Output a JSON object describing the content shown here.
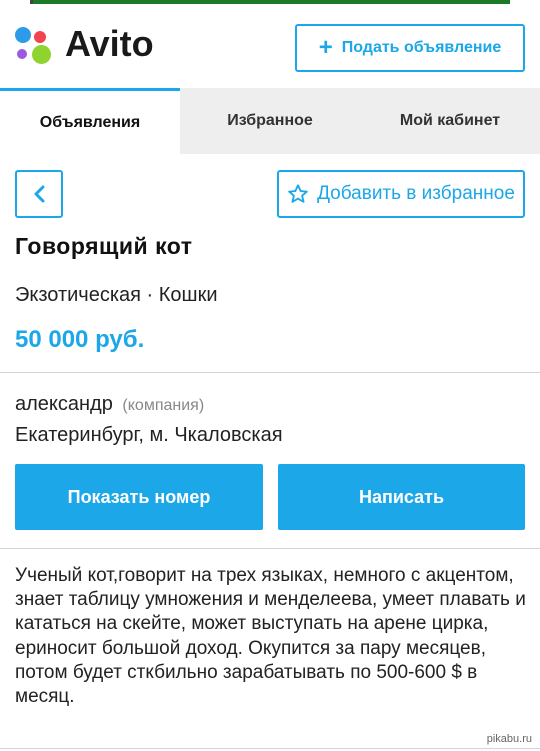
{
  "header": {
    "logo_text": "Avito",
    "post_ad_label": "Подать объявление"
  },
  "tabs": [
    {
      "label": "Объявления",
      "active": true
    },
    {
      "label": "Избранное",
      "active": false
    },
    {
      "label": "Мой кабинет",
      "active": false
    }
  ],
  "actions": {
    "add_favorite_label": "Добавить в избранное"
  },
  "listing": {
    "title": "Говорящий кот",
    "category": "Экзотическая · Кошки",
    "price": "50 000 руб.",
    "seller_name": "александр",
    "seller_type": "(компания)",
    "location": "Екатеринбург, м. Чкаловская",
    "show_phone_label": "Показать номер",
    "write_label": "Написать",
    "description": "Ученый кот,говорит на трех языках, немного с акцентом, знает таблицу умножения и менделеева, умеет плавать и кататься на скейте, может выступать на арене цирка, ериносит большой доход. Окупится за пару месяцев, потом будет сткбильно зарабатывать по 500-600 $ в месяц."
  },
  "watermark": "pikabu.ru",
  "colors": {
    "accent": "#1ba7e8",
    "logo_blue": "#2e9be8",
    "logo_red": "#f2444e",
    "logo_purple": "#9a5ae3",
    "logo_green": "#8fd32f"
  },
  "icons": {
    "plus": "plus-icon",
    "back": "chevron-left-icon",
    "favorite": "star-icon"
  }
}
